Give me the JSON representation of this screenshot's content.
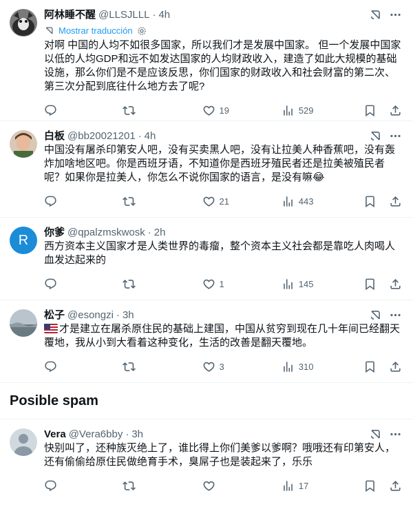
{
  "tweets": [
    {
      "name": "阿林睡不醒",
      "handle": "@LLSJLLL",
      "time": "4h",
      "translate_label": "Mostrar traducción",
      "text": "对啊 中国的人均不如很多国家，所以我们才是发展中国家。 但一个发展中国家以低的人均GDP和远不如发达国家的人均财政收入，建造了如此大规模的基础设施，那么你们是不是应该反思，你们国家的财政收入和社会财富的第二次、第三次分配到底往什么地方去了呢?",
      "likes": "19",
      "views": "529"
    },
    {
      "name": "白板",
      "handle": "@bb20021201",
      "time": "4h",
      "text": "中国没有屠杀印第安人吧，没有买卖黑人吧，没有让拉美人种香蕉吧，没有轰炸加啥地区吧。你是西班牙语，不知道你是西班牙殖民者还是拉美被殖民者呢？如果你是拉美人，你怎么不说你国家的语言，是没有嘛😂",
      "likes": "21",
      "views": "443"
    },
    {
      "name": "你爹",
      "handle": "@qpalzmskwosk",
      "time": "2h",
      "avatar_letter": "R",
      "text": "西方资本主义国家才是人类世界的毒瘤，整个资本主义社会都是靠吃人肉喝人血发达起来的",
      "likes": "1",
      "views": "145"
    },
    {
      "name": "松子",
      "handle": "@esongzi",
      "time": "3h",
      "text": "才是建立在屠杀原住民的基础上建国，中国从贫穷到现在几十年间已经翻天覆地，我从小到大看着这种变化，生活的改善是翻天覆地。",
      "likes": "3",
      "views": "310"
    }
  ],
  "spam_section": {
    "title": "Posible spam",
    "tweet": {
      "name": "Vera",
      "handle": "@Vera6bby",
      "time": "3h",
      "text": "快别叫了，还种族灭绝上了，谁比得上你们美爹以爹啊？哦哦还有印第安人，还有偷偷给原住民做绝育手术，臭屌子也是装起来了，乐乐",
      "likes": "",
      "views": "17"
    }
  },
  "colors": {
    "accent": "#1d9bf0",
    "secondary_text": "#536471",
    "avatar_R_bg": "#1a8cd8"
  },
  "icons": [
    "grok-icon",
    "more-icon",
    "translate-icon",
    "gear-icon",
    "reply-icon",
    "retweet-icon",
    "like-icon",
    "views-icon",
    "bookmark-icon",
    "share-icon",
    "us-flag-icon"
  ]
}
